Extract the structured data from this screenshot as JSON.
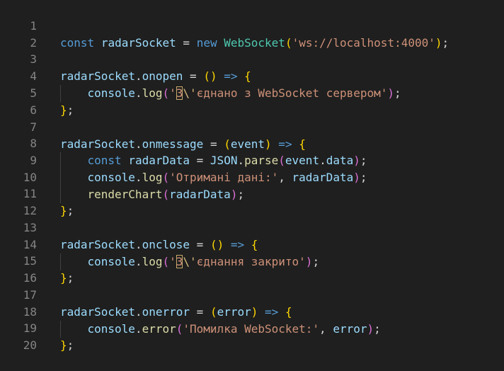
{
  "line_numbers": [
    "1",
    "2",
    "3",
    "4",
    "5",
    "6",
    "7",
    "8",
    "9",
    "10",
    "11",
    "12",
    "13",
    "14",
    "15",
    "16",
    "17",
    "18",
    "19",
    "20"
  ],
  "code": {
    "l1": {
      "const": "const",
      "name": "radarSocket",
      "eq": " = ",
      "new": "new",
      "cls": "WebSocket",
      "open": "(",
      "url": "'ws://localhost:4000'",
      "close": ")",
      "semi": ";"
    },
    "l3": {
      "obj": "radarSocket",
      "dot": ".",
      "prop": "onopen",
      "eq": " = ",
      "params": "()",
      "arrow": " => ",
      "brace": "{"
    },
    "l4": {
      "console": "console",
      "dot": ".",
      "method": "log",
      "open": "(",
      "q": "'",
      "char": "З",
      "esc": "\\'",
      "rest": "єднано з WebSocket сервером'",
      "close": ")",
      "semi": ";"
    },
    "l5": {
      "brace": "}",
      "semi": ";"
    },
    "l7": {
      "obj": "radarSocket",
      "dot": ".",
      "prop": "onmessage",
      "eq": " = ",
      "p_open": "(",
      "param": "event",
      "p_close": ")",
      "arrow": " => ",
      "brace": "{"
    },
    "l8": {
      "const": "const",
      "name": "radarData",
      "eq": " = ",
      "json": "JSON",
      "dot": ".",
      "method": "parse",
      "open": "(",
      "arg1": "event",
      "dot2": ".",
      "arg2": "data",
      "close": ")",
      "semi": ";"
    },
    "l9": {
      "console": "console",
      "dot": ".",
      "method": "log",
      "open": "(",
      "str": "'Отримані дані:'",
      "comma": ", ",
      "arg": "radarData",
      "close": ")",
      "semi": ";"
    },
    "l10": {
      "fn": "renderChart",
      "open": "(",
      "arg": "radarData",
      "close": ")",
      "semi": ";"
    },
    "l11": {
      "brace": "}",
      "semi": ";"
    },
    "l13": {
      "obj": "radarSocket",
      "dot": ".",
      "prop": "onclose",
      "eq": " = ",
      "params": "()",
      "arrow": " => ",
      "brace": "{"
    },
    "l14": {
      "console": "console",
      "dot": ".",
      "method": "log",
      "open": "(",
      "q": "'",
      "char": "З",
      "esc": "\\'",
      "rest": "єднання закрито'",
      "close": ")",
      "semi": ";"
    },
    "l15": {
      "brace": "}",
      "semi": ";"
    },
    "l17": {
      "obj": "radarSocket",
      "dot": ".",
      "prop": "onerror",
      "eq": " = ",
      "p_open": "(",
      "param": "error",
      "p_close": ")",
      "arrow": " => ",
      "brace": "{"
    },
    "l18": {
      "console": "console",
      "dot": ".",
      "method": "error",
      "open": "(",
      "str": "'Помилка WebSocket:'",
      "comma": ", ",
      "arg": "error",
      "close": ")",
      "semi": ";"
    },
    "l19": {
      "brace": "}",
      "semi": ";"
    }
  }
}
